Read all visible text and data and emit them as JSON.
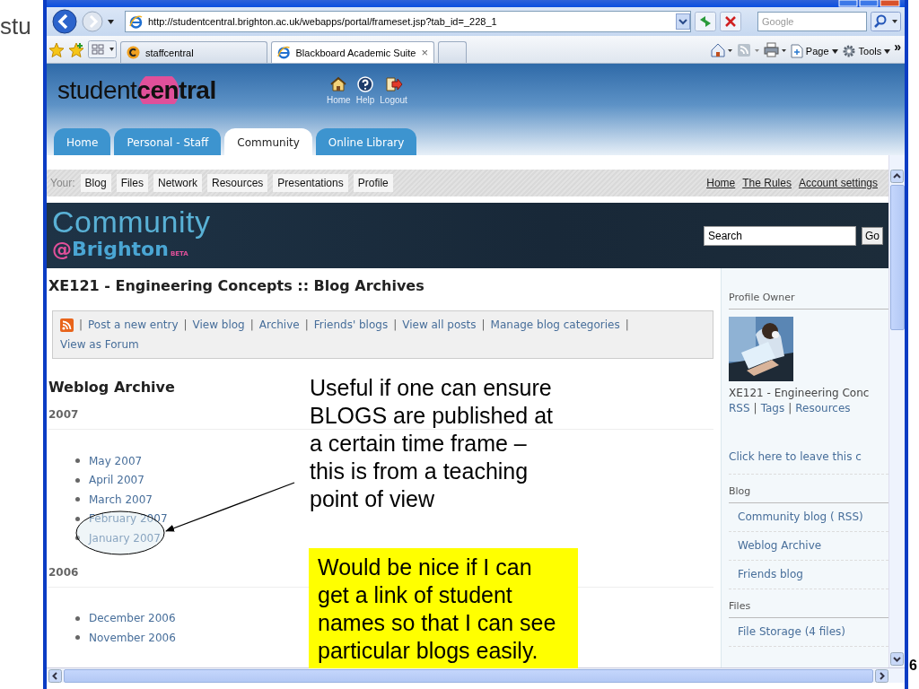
{
  "slide": {
    "title": "stu",
    "page_number": "6"
  },
  "browser": {
    "url": "http://studentcentral.brighton.ac.uk/webapps/portal/frameset.jsp?tab_id=_228_1",
    "search_placeholder": "Google",
    "tabs": [
      {
        "label": "staffcentral",
        "selected": false
      },
      {
        "label": "Blackboard Academic Suite",
        "selected": true
      }
    ],
    "tab_close": "×",
    "commands": [
      {
        "kind": "page",
        "label": "Page"
      },
      {
        "kind": "tools",
        "label": "Tools"
      }
    ],
    "overflow": "»"
  },
  "site": {
    "logo": {
      "light": "student",
      "bold": "central"
    },
    "header_links": [
      {
        "kind": "home",
        "label": "Home"
      },
      {
        "kind": "help",
        "label": "Help"
      },
      {
        "kind": "logout",
        "label": "Logout"
      }
    ],
    "tabs": [
      {
        "label": "Home",
        "selected": false
      },
      {
        "label": "Personal - Staff",
        "selected": false
      },
      {
        "label": "Community",
        "selected": true
      },
      {
        "label": "Online Library",
        "selected": false
      }
    ],
    "nav": {
      "prefix": "Your:",
      "buttons": [
        "Blog",
        "Files",
        "Network",
        "Resources",
        "Presentations",
        "Profile"
      ],
      "links": [
        "Home",
        "The Rules",
        "Account settings"
      ]
    },
    "banner": {
      "title": "Community",
      "brand_at": "@",
      "brand": "Brighton",
      "badge": "BETA",
      "search_value": "Search",
      "go": "Go"
    },
    "page": {
      "heading": "XE121 - Engineering Concepts :: Blog Archives",
      "separator": "|",
      "actions": [
        "Post a new entry",
        "View blog",
        "Archive",
        "Friends' blogs",
        "View all posts",
        "Manage blog categories",
        "View as Forum"
      ],
      "archive_title": "Weblog Archive",
      "years": [
        {
          "year": "2007",
          "months": [
            "May 2007",
            "April 2007",
            "March 2007",
            "February 2007",
            "January 2007"
          ]
        },
        {
          "year": "2006",
          "months": [
            "December 2006",
            "November 2006"
          ]
        }
      ]
    },
    "sidebar": {
      "profile_heading": "Profile Owner",
      "profile_name": "XE121 - Engineering Conc",
      "profile_links": [
        "RSS",
        "Tags",
        "Resources"
      ],
      "leave_link": "Click here to leave this c",
      "sections": [
        {
          "heading": "Blog",
          "items": [
            "Community blog ( RSS)",
            "Weblog Archive",
            "Friends blog"
          ]
        },
        {
          "heading": "Files",
          "items": [
            "File Storage (4 files)"
          ]
        }
      ]
    }
  },
  "annotations": {
    "callout": "Useful if one can ensure BLOGS are published at a certain time frame – this is from a teaching point of view",
    "note": "Would be nice if I can get a link of student names so that I can see particular blogs easily."
  }
}
